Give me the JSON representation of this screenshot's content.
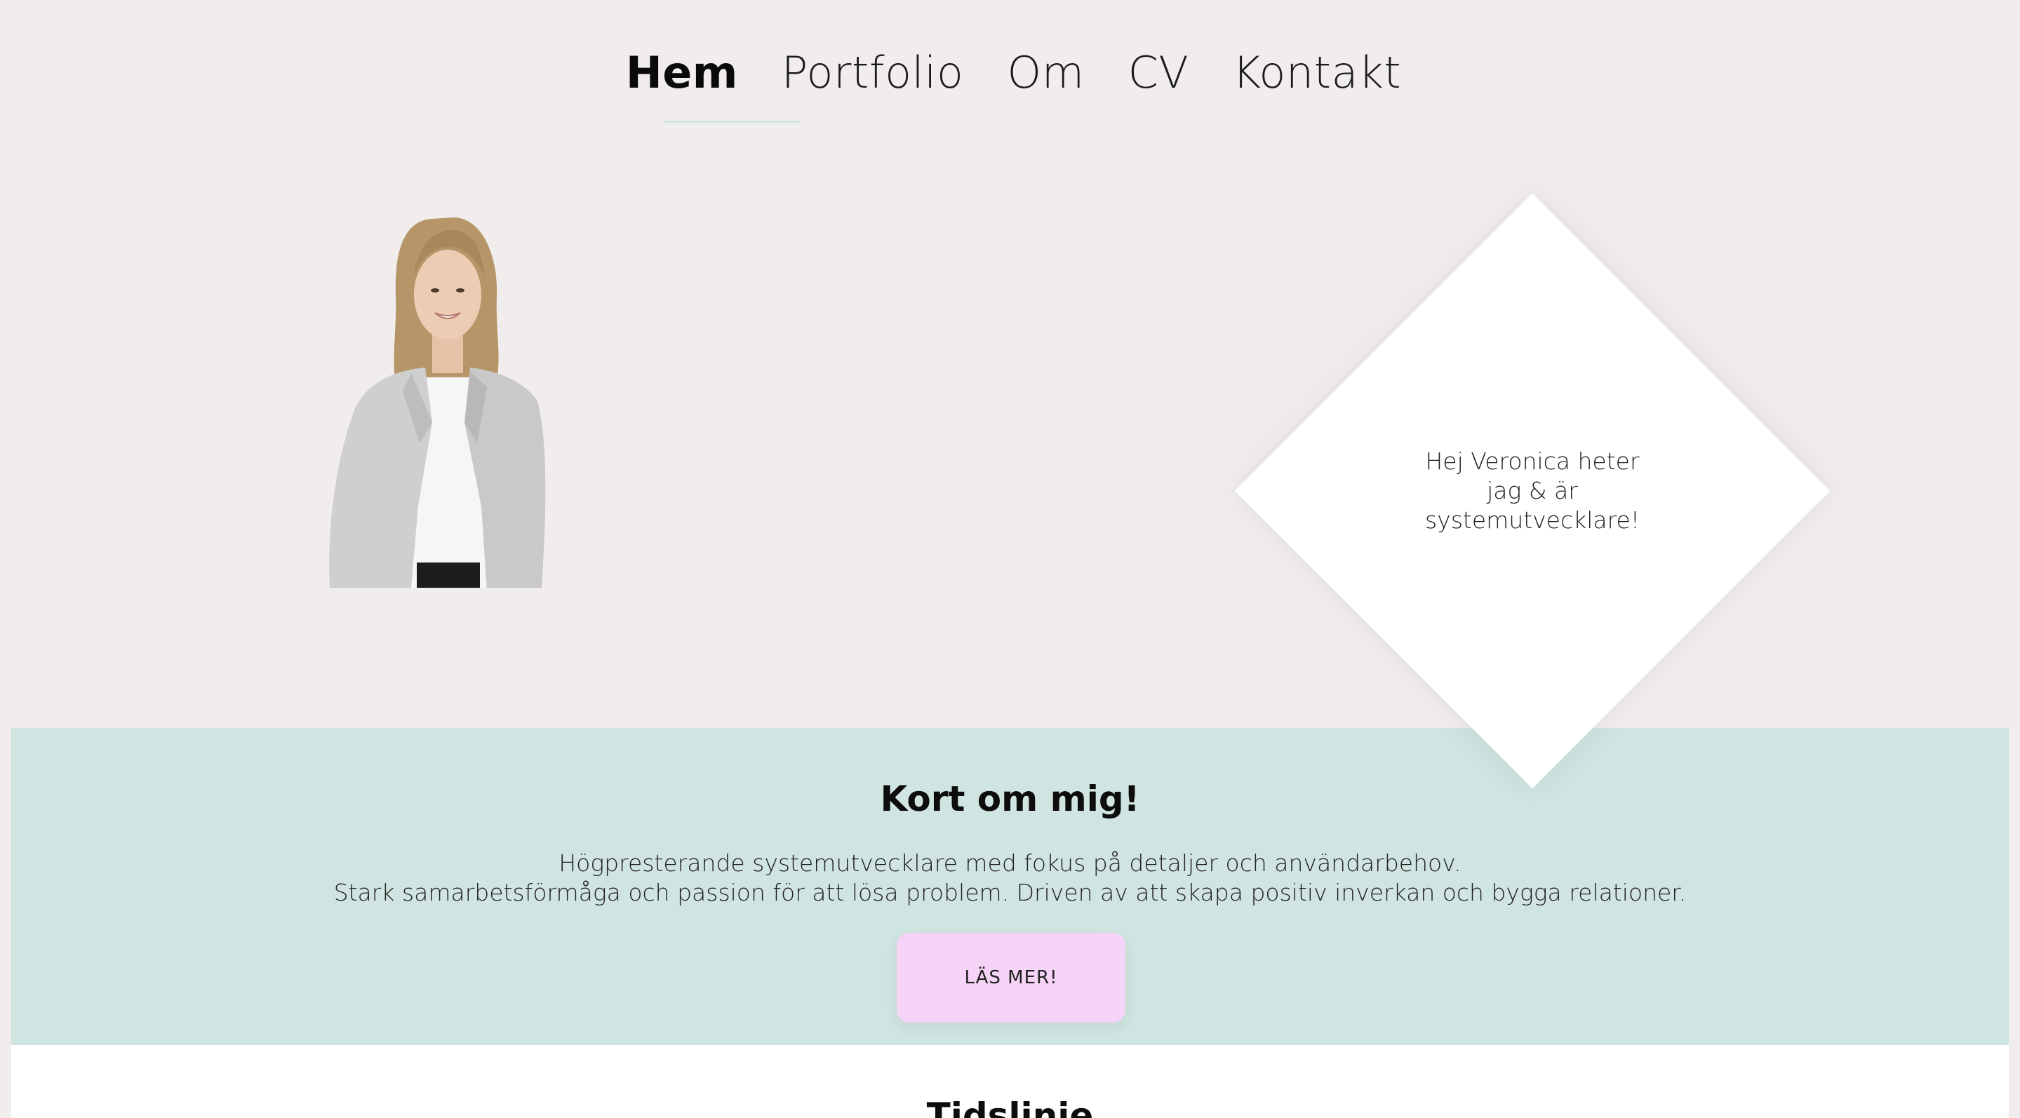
{
  "nav": {
    "items": [
      {
        "label": "Hem",
        "active": true
      },
      {
        "label": "Portfolio",
        "active": false
      },
      {
        "label": "Om",
        "active": false
      },
      {
        "label": "CV",
        "active": false
      },
      {
        "label": "Kontakt",
        "active": false
      }
    ]
  },
  "hero": {
    "intro_line1": "Hej Veronica heter jag & är",
    "intro_line2": "systemutvecklare!"
  },
  "about": {
    "title": "Kort om mig!",
    "line1": "Högpresterande systemutvecklare med fokus på detaljer och användarbehov.",
    "line2": "Stark samarbetsförmåga och passion för att lösa problem. Driven av att skapa positiv inverkan och bygga relationer.",
    "button_label": "LÄS MER!"
  },
  "timeline": {
    "title": "Tidslinje"
  },
  "colors": {
    "page_bg": "#f0edec",
    "about_bg": "#d0e5e1",
    "button_bg": "#f5d4f7",
    "nav_underline": "#cfe5e1",
    "card_bg": "#ffffff"
  }
}
